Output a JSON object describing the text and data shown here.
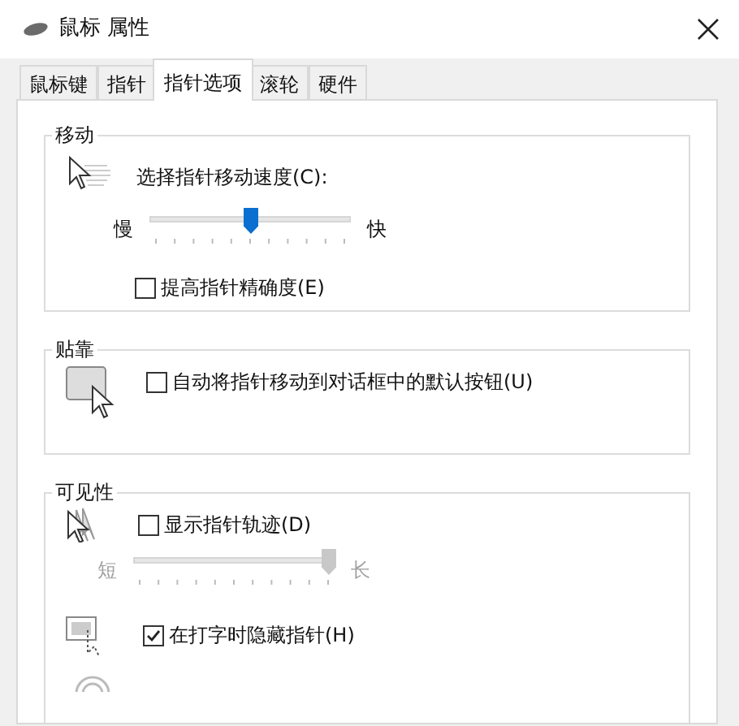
{
  "window": {
    "title": "鼠标 属性"
  },
  "tabs": [
    {
      "label": "鼠标键",
      "selected": false
    },
    {
      "label": "指针",
      "selected": false
    },
    {
      "label": "指针选项",
      "selected": true
    },
    {
      "label": "滚轮",
      "selected": false
    },
    {
      "label": "硬件",
      "selected": false
    }
  ],
  "motion": {
    "title": "移动",
    "speed_label": "选择指针移动速度(C):",
    "slow_label": "慢",
    "fast_label": "快",
    "speed_slider": {
      "level": 0.5,
      "disabled": false
    },
    "enhance_precision": {
      "label": "提高指针精确度(E)",
      "checked": false
    }
  },
  "snap_to": {
    "title": "贴靠",
    "snap": {
      "label": "自动将指针移动到对话框中的默认按钮(U)",
      "checked": false
    }
  },
  "visibility": {
    "title": "可见性",
    "trails": {
      "label": "显示指针轨迹(D)",
      "checked": false
    },
    "short_label": "短",
    "long_label": "长",
    "trail_slider": {
      "level": 1,
      "disabled": true
    },
    "hide_while_typing": {
      "label": "在打字时隐藏指针(H)",
      "checked": true
    }
  }
}
